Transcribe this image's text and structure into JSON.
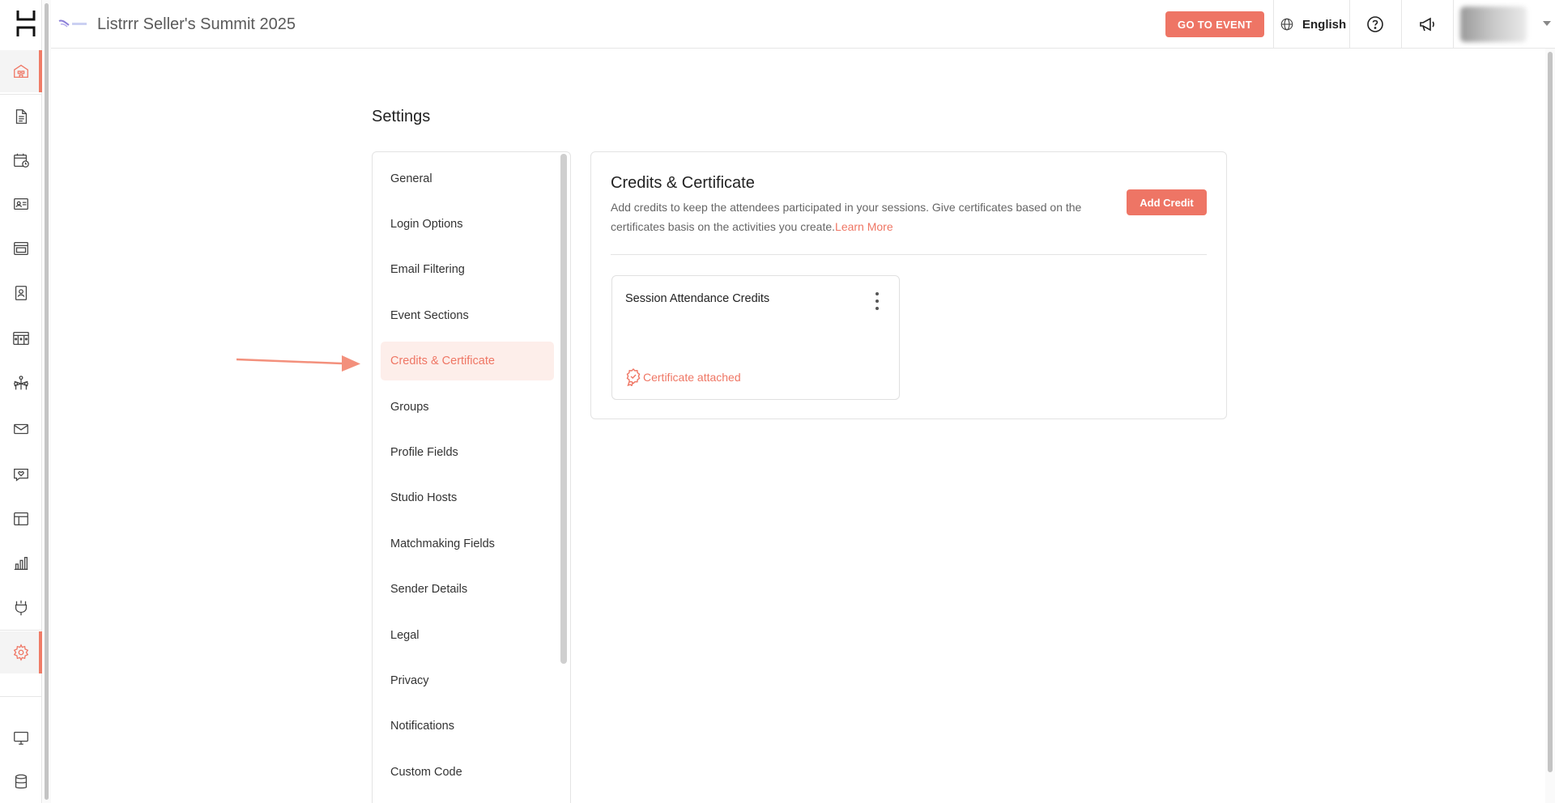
{
  "topbar": {
    "event_title": "Listrrr Seller's Summit 2025",
    "go_to_event_label": "GO TO EVENT",
    "language": "English"
  },
  "rail": {
    "icons": [
      "home-icon",
      "document-icon",
      "calendar-icon",
      "id-card-icon",
      "layout-icon",
      "badge-icon",
      "booths-icon",
      "networking-icon",
      "mail-icon",
      "chat-heart-icon",
      "template-icon",
      "analytics-icon",
      "integrations-plug-icon",
      "settings-gear-icon",
      "display-icon",
      "database-icon"
    ],
    "active": "settings-gear-icon"
  },
  "settings": {
    "title": "Settings",
    "nav": [
      {
        "label": "General"
      },
      {
        "label": "Login Options"
      },
      {
        "label": "Email Filtering"
      },
      {
        "label": "Event Sections"
      },
      {
        "label": "Credits & Certificate"
      },
      {
        "label": "Groups"
      },
      {
        "label": "Profile Fields"
      },
      {
        "label": "Studio Hosts"
      },
      {
        "label": "Matchmaking Fields"
      },
      {
        "label": "Sender Details"
      },
      {
        "label": "Legal"
      },
      {
        "label": "Privacy"
      },
      {
        "label": "Notifications"
      },
      {
        "label": "Custom Code"
      }
    ],
    "active_nav": "Credits & Certificate"
  },
  "content": {
    "title": "Credits & Certificate",
    "description": "Add credits to keep the attendees participated in your sessions. Give certificates based on the certificates basis on the activities you create.",
    "learn_more": "Learn More",
    "add_credit_label": "Add Credit",
    "credits": [
      {
        "name": "Session Attendance Credits",
        "status": "Certificate attached"
      }
    ]
  },
  "colors": {
    "accent": "#ee7565",
    "active_bg": "#fdeeea"
  }
}
